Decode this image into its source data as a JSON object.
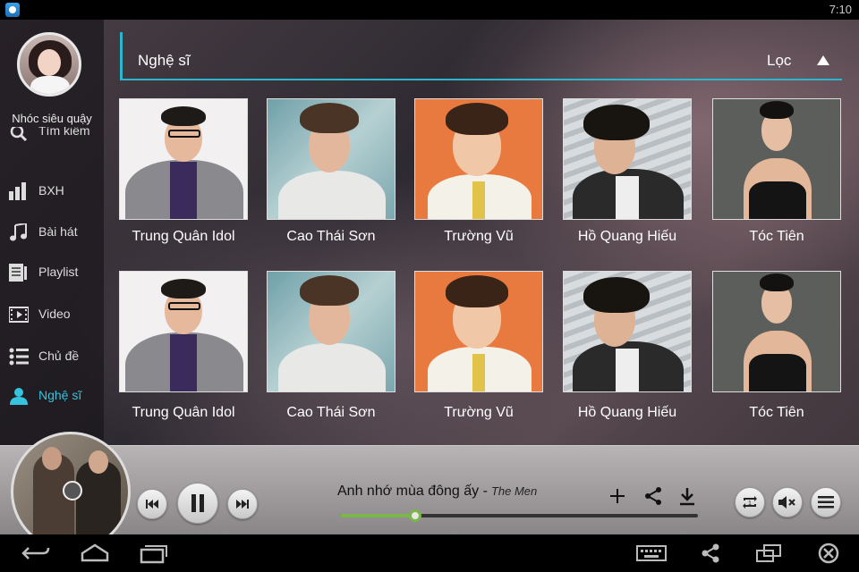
{
  "status_bar": {
    "time": "7:10"
  },
  "user": {
    "name": "Nhóc siêu quậy"
  },
  "sidebar": {
    "items": [
      {
        "label": "Tìm kiếm",
        "icon": "search-icon"
      },
      {
        "label": "BXH",
        "icon": "chart-icon"
      },
      {
        "label": "Bài hát",
        "icon": "music-note-icon"
      },
      {
        "label": "Playlist",
        "icon": "playlist-icon"
      },
      {
        "label": "Video",
        "icon": "video-icon"
      },
      {
        "label": "Chủ đề",
        "icon": "topic-list-icon"
      },
      {
        "label": "Nghệ sĩ",
        "icon": "artist-icon",
        "active": true
      }
    ]
  },
  "header": {
    "title": "Nghệ sĩ",
    "filter_label": "Lọc"
  },
  "artists": [
    {
      "name": "Trung Quân Idol"
    },
    {
      "name": "Cao Thái Sơn"
    },
    {
      "name": "Trường Vũ"
    },
    {
      "name": "Hồ Quang Hiếu"
    },
    {
      "name": "Tóc Tiên"
    },
    {
      "name": "Trung Quân Idol"
    },
    {
      "name": "Cao Thái Sơn"
    },
    {
      "name": "Trường Vũ"
    },
    {
      "name": "Hồ Quang Hiếu"
    },
    {
      "name": "Tóc Tiên"
    }
  ],
  "player": {
    "song_title": "Anh nhớ mùa đông ấy -",
    "artist": "The Men",
    "progress": 0.21
  },
  "colors": {
    "accent": "#2bb6cf",
    "progress": "#7ab648"
  }
}
